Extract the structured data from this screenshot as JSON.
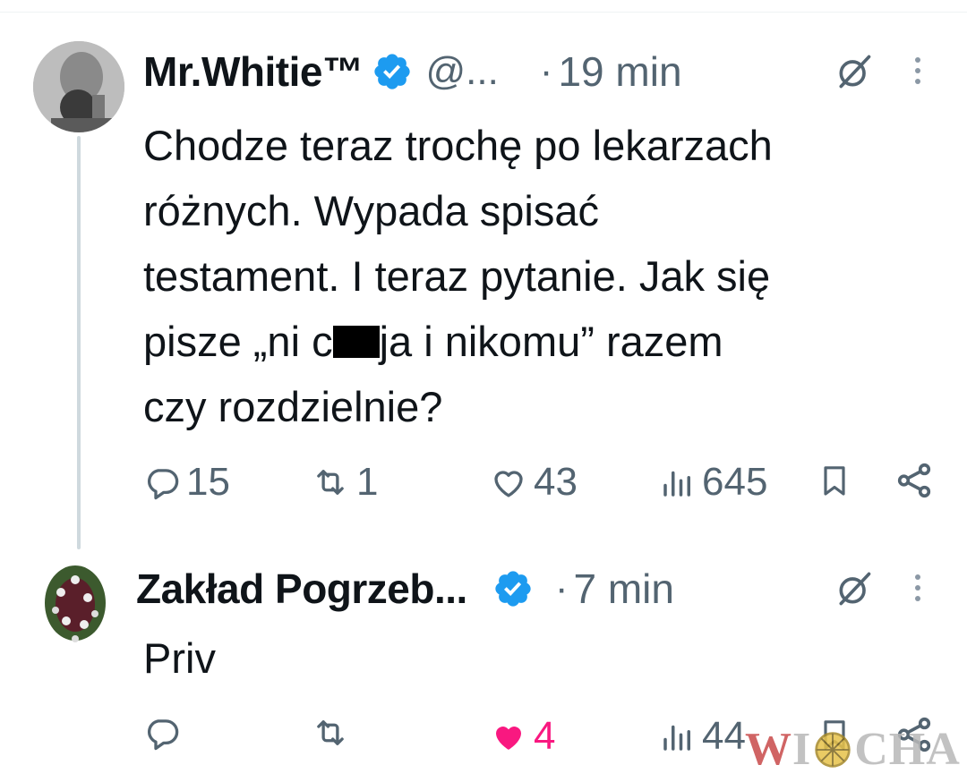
{
  "tweet": {
    "author_name": "Mr.Whitie™",
    "handle": "@...",
    "time": "19 min",
    "dot": "·",
    "text_lines": [
      "Chodze teraz trochę po lekarzach",
      "różnych. Wypada spisać",
      "testament. I teraz pytanie. Jak się"
    ],
    "line4_before": "pisze „ni c",
    "line4_after": "ja i nikomu” razem",
    "line5": "czy rozdzielnie?",
    "replies": "15",
    "reposts": "1",
    "likes": "43",
    "views": "645"
  },
  "reply": {
    "author_name": "Zakład Pogrzeb...",
    "time": "7 min",
    "dot": "·",
    "text": "Priv",
    "replies": "",
    "reposts": "",
    "likes": "4",
    "views": "44"
  },
  "watermark": {
    "pre": "W",
    "post": "CHA"
  },
  "colors": {
    "verified": "#1d9bf0",
    "secondary": "#536471",
    "like": "#f91880",
    "thread_line": "#cfd9de"
  },
  "icons": [
    "reply-icon",
    "repost-icon",
    "like-icon",
    "views-icon",
    "bookmark-icon",
    "share-icon",
    "grok-icon",
    "more-icon",
    "verified-badge-icon"
  ]
}
